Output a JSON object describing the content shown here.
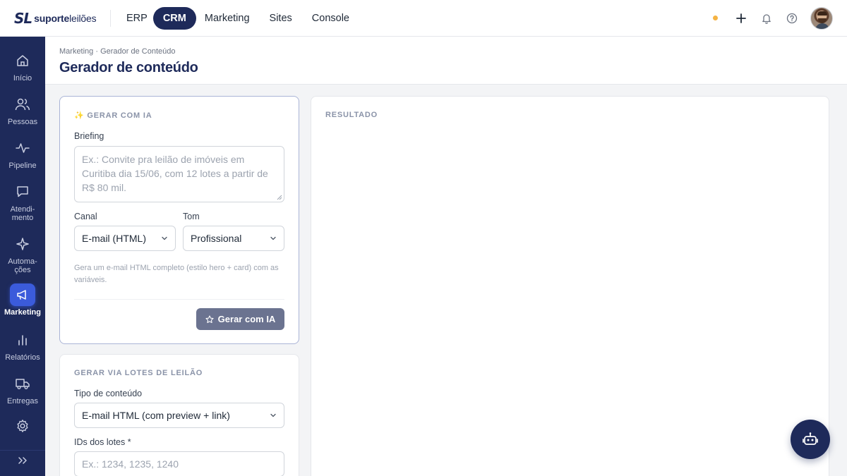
{
  "brand": {
    "mark": "SL",
    "name_bold": "suporte",
    "name_light": "leilões"
  },
  "topnav": [
    {
      "label": "ERP",
      "active": false
    },
    {
      "label": "CRM",
      "active": true
    },
    {
      "label": "Marketing",
      "active": false
    },
    {
      "label": "Sites",
      "active": false
    },
    {
      "label": "Console",
      "active": false
    }
  ],
  "topbar_icons": [
    "status-dot",
    "plus-icon",
    "bell-icon",
    "help-icon",
    "avatar"
  ],
  "sidebar": [
    {
      "label": "Início",
      "icon": "home-icon"
    },
    {
      "label": "Pessoas",
      "icon": "users-icon"
    },
    {
      "label": "Pipeline",
      "icon": "pulse-icon"
    },
    {
      "label": "Atendi-\nmento",
      "icon": "chat-icon"
    },
    {
      "label": "Automa-\nções",
      "icon": "sparkle-icon"
    },
    {
      "label": "Marketing",
      "icon": "megaphone-icon",
      "active": true
    },
    {
      "label": "Relatórios",
      "icon": "bar-chart-icon"
    },
    {
      "label": "Entregas",
      "icon": "truck-icon"
    },
    {
      "label": "",
      "icon": "gear-icon"
    }
  ],
  "header": {
    "breadcrumb": "Marketing · Gerador de Conteúdo",
    "title": "Gerador de conteúdo"
  },
  "ia_card": {
    "section_title": "✨ GERAR COM IA",
    "briefing_label": "Briefing",
    "briefing_placeholder": "Ex.: Convite pra leilão de imóveis em Curitiba dia 15/06, com 12 lotes a partir de R$ 80 mil.",
    "canal_label": "Canal",
    "canal_value": "E-mail (HTML)",
    "tom_label": "Tom",
    "tom_value": "Profissional",
    "hint": "Gera um e-mail HTML completo (estilo hero + card) com as variáveis.",
    "button_label": "Gerar com IA"
  },
  "lotes_card": {
    "section_title": "GERAR VIA LOTES DE LEILÃO",
    "tipo_label": "Tipo de conteúdo",
    "tipo_value": "E-mail HTML (com preview + link)",
    "ids_label": "IDs dos lotes *",
    "ids_placeholder": "Ex.: 1234, 1235, 1240"
  },
  "result_card": {
    "section_title": "RESULTADO"
  },
  "colors": {
    "navy": "#1e2a5a",
    "accent": "#3b5bdb",
    "status_dot": "#f5b342",
    "button": "#6b7390"
  }
}
